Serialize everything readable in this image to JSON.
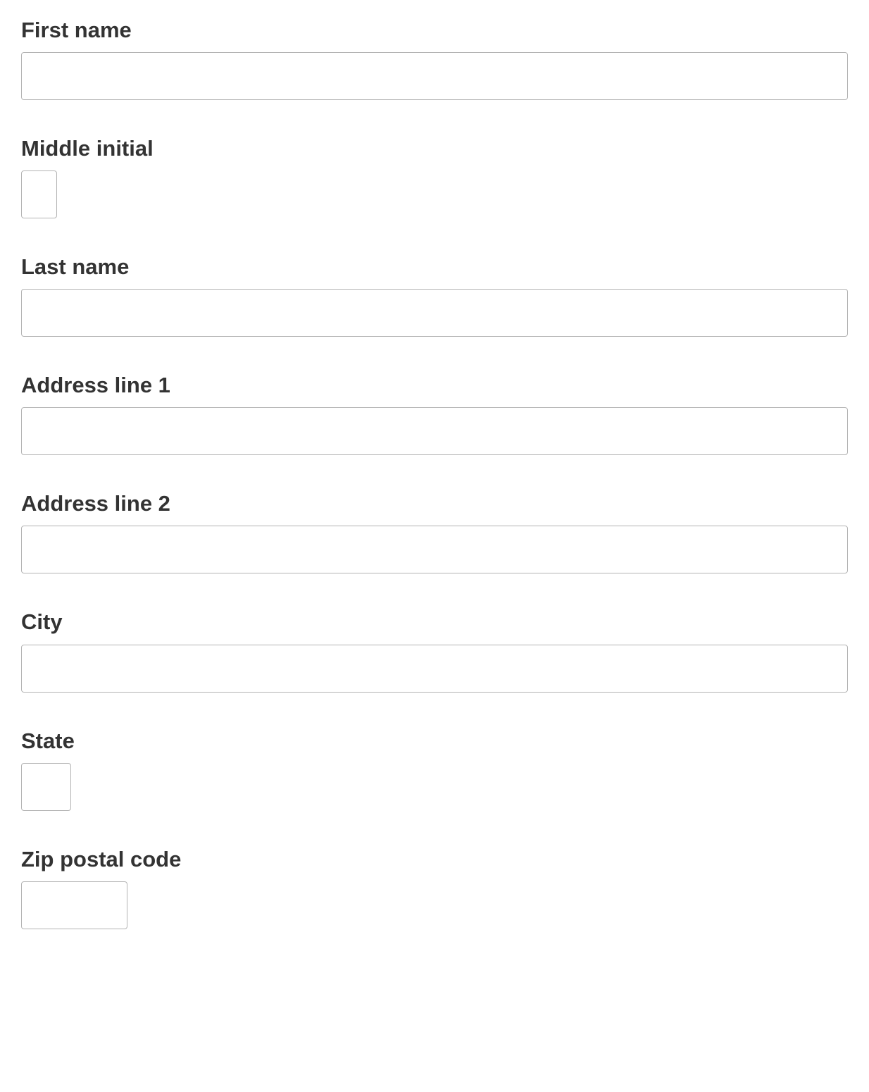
{
  "form": {
    "first_name": {
      "label": "First name",
      "value": ""
    },
    "middle_initial": {
      "label": "Middle initial",
      "value": ""
    },
    "last_name": {
      "label": "Last name",
      "value": ""
    },
    "address_1": {
      "label": "Address line 1",
      "value": ""
    },
    "address_2": {
      "label": "Address line 2",
      "value": ""
    },
    "city": {
      "label": "City",
      "value": ""
    },
    "state": {
      "label": "State",
      "value": ""
    },
    "zip": {
      "label": "Zip postal code",
      "value": ""
    }
  }
}
